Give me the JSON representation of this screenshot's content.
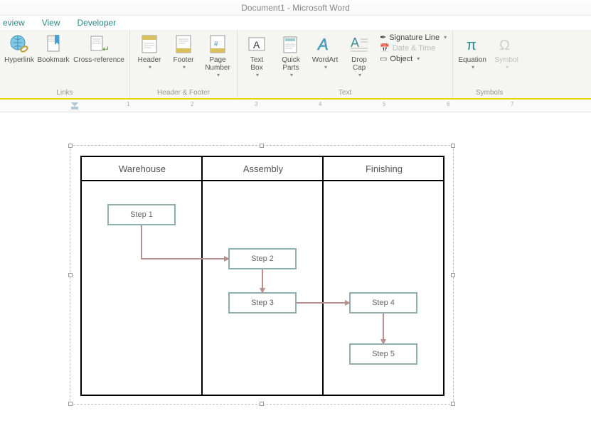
{
  "title": "Document1 - Microsoft Word",
  "menu": {
    "review": "eview",
    "view": "View",
    "developer": "Developer"
  },
  "ribbon": {
    "links": {
      "label": "Links",
      "hyperlink": "Hyperlink",
      "bookmark": "Bookmark",
      "crossref": "Cross-reference"
    },
    "hf": {
      "label": "Header & Footer",
      "header": "Header",
      "footer": "Footer",
      "pagenum": "Page\nNumber"
    },
    "text": {
      "label": "Text",
      "textbox": "Text\nBox",
      "quickparts": "Quick\nParts",
      "wordart": "WordArt",
      "dropcap": "Drop\nCap",
      "sigline": "Signature Line",
      "datetime": "Date & Time",
      "object": "Object"
    },
    "symbols": {
      "label": "Symbols",
      "equation": "Equation",
      "symbol": "Symbol"
    }
  },
  "ruler": {
    "n1": "1",
    "n2": "2",
    "n3": "3",
    "n4": "4",
    "n5": "5",
    "n6": "6",
    "n7": "7"
  },
  "swimlane": {
    "cols": [
      "Warehouse",
      "Assembly",
      "Finishing"
    ],
    "steps": [
      "Step 1",
      "Step 2",
      "Step 3",
      "Step 4",
      "Step 5"
    ]
  },
  "chart_data": {
    "type": "table",
    "title": "Swimlane flowchart",
    "lanes": [
      "Warehouse",
      "Assembly",
      "Finishing"
    ],
    "nodes": [
      {
        "id": "Step 1",
        "lane": "Warehouse"
      },
      {
        "id": "Step 2",
        "lane": "Assembly"
      },
      {
        "id": "Step 3",
        "lane": "Assembly"
      },
      {
        "id": "Step 4",
        "lane": "Finishing"
      },
      {
        "id": "Step 5",
        "lane": "Finishing"
      }
    ],
    "edges": [
      [
        "Step 1",
        "Step 2"
      ],
      [
        "Step 2",
        "Step 3"
      ],
      [
        "Step 3",
        "Step 4"
      ],
      [
        "Step 4",
        "Step 5"
      ]
    ]
  }
}
